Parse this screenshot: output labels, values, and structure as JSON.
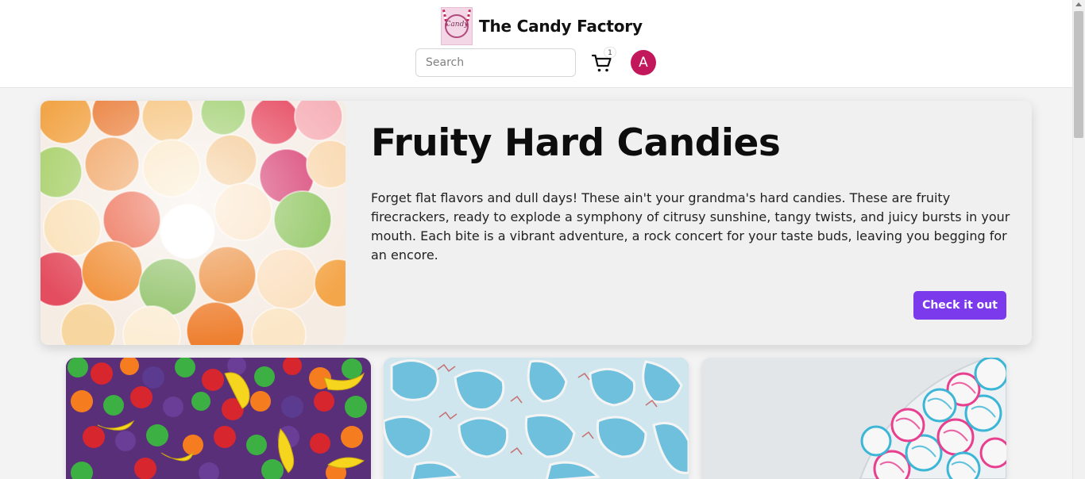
{
  "header": {
    "brand_name": "The Candy Factory",
    "logo_text": "Candy",
    "search_placeholder": "Search",
    "cart_count": "1",
    "avatar_initial": "A"
  },
  "colors": {
    "accent": "#7c3aed",
    "avatar": "#c2185b",
    "background": "#f3f3f3"
  },
  "hero": {
    "title": "Fruity Hard Candies",
    "description": "Forget flat flavors and dull days! These ain't your grandma's hard candies. These are fruity firecrackers, ready to explode a symphony of citrusy sunshine, tangy twists, and juicy bursts in your mouth. Each bite is a vibrant adventure, a rock concert for your taste buds, leaving you begging for an encore.",
    "button_label": "Check it out",
    "image": "fruity-hard-candies-photo"
  },
  "cards": [
    {
      "image": "fruit-shaped-candies-photo"
    },
    {
      "image": "blue-salt-water-taffy-photo"
    },
    {
      "image": "striped-candy-balls-photo"
    }
  ],
  "icons": {
    "cart": "cart-icon",
    "user": "avatar"
  }
}
